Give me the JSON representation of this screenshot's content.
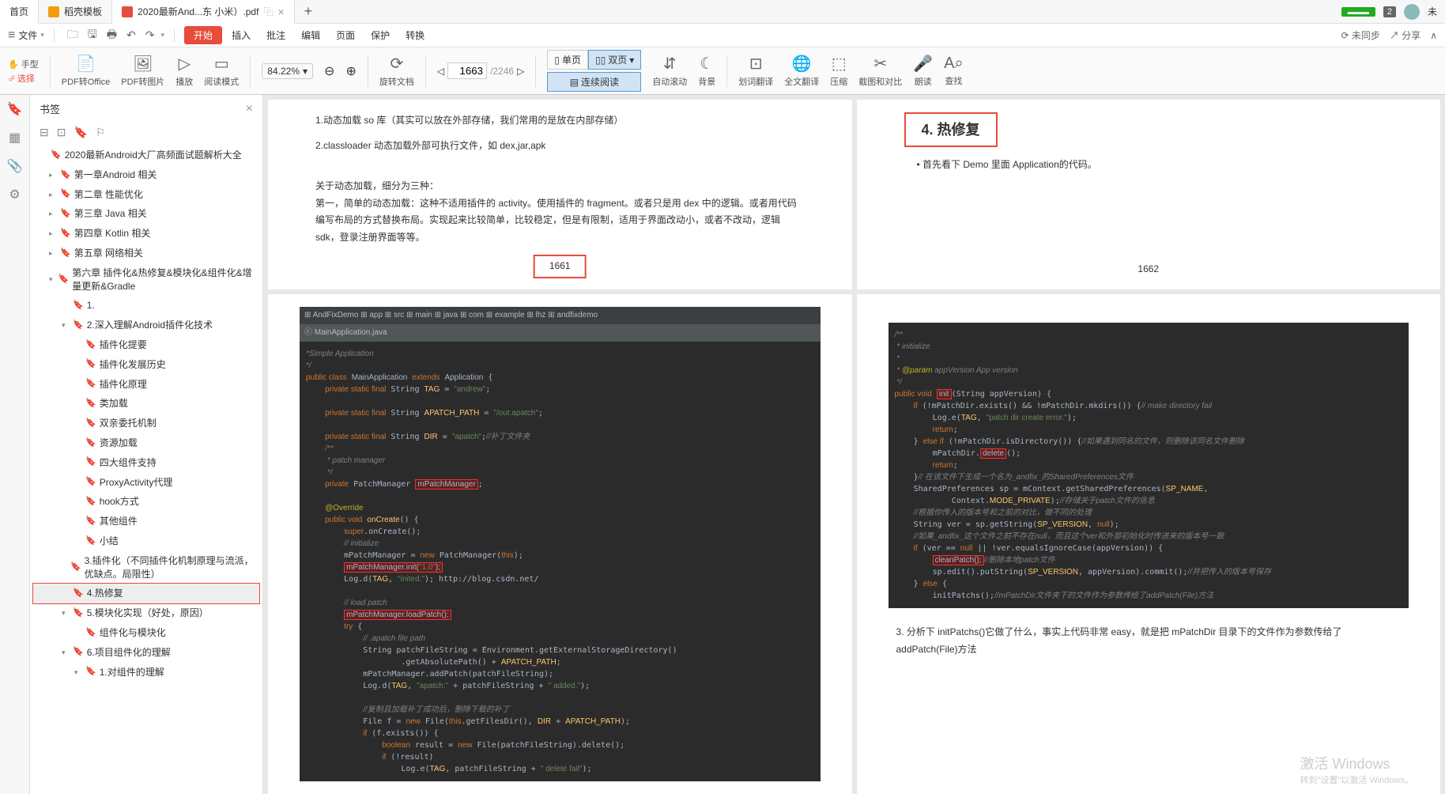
{
  "tabs": {
    "home": "首页",
    "template": "稻壳模板",
    "active": "2020最新And...东 小米）.pdf",
    "plus": "+"
  },
  "topRight": {
    "badge": "2",
    "user": "未"
  },
  "menubar": {
    "file": "文件",
    "start": "开始",
    "items": [
      "插入",
      "批注",
      "编辑",
      "页面",
      "保护",
      "转换"
    ],
    "right": {
      "notsync": "⟳ 未同步",
      "share": "↗ 分享"
    }
  },
  "tools": {
    "hand": "手型",
    "select": "选择",
    "pdf2office": "PDF转Office",
    "pdf2img": "PDF转图片",
    "play": "播放",
    "readmode": "阅读模式",
    "zoom": "84.22%",
    "rotate": "旋转文档",
    "page_current": "1663",
    "page_total": "/2246",
    "single": "单页",
    "double": "双页",
    "continuous": "连续阅读",
    "autoscroll": "自动滚动",
    "background": "背景",
    "wordtrans": "划词翻译",
    "fulltrans": "全文翻译",
    "compress": "压缩",
    "screenshot": "截图和对比",
    "read_aloud": "朗读",
    "find": "查找"
  },
  "sidebar": {
    "title": "书签",
    "tree": [
      {
        "lvl": 0,
        "label": "2020最新Android大厂高频面试题解析大全"
      },
      {
        "lvl": 1,
        "exp": false,
        "label": "第一章Android 相关"
      },
      {
        "lvl": 1,
        "exp": false,
        "label": "第二章 性能优化"
      },
      {
        "lvl": 1,
        "exp": false,
        "label": "第三章 Java 相关"
      },
      {
        "lvl": 1,
        "exp": false,
        "label": "第四章 Kotlin 相关"
      },
      {
        "lvl": 1,
        "exp": false,
        "label": "第五章 网络相关"
      },
      {
        "lvl": 1,
        "exp": true,
        "label": "第六章 插件化&热修复&模块化&组件化&增量更新&Gradle"
      },
      {
        "lvl": 2,
        "label": "1."
      },
      {
        "lvl": 2,
        "exp": true,
        "label": "2.深入理解Android插件化技术"
      },
      {
        "lvl": 3,
        "label": "插件化提要"
      },
      {
        "lvl": 3,
        "label": "插件化发展历史"
      },
      {
        "lvl": 3,
        "label": "插件化原理"
      },
      {
        "lvl": 3,
        "label": "类加载"
      },
      {
        "lvl": 3,
        "label": "双亲委托机制"
      },
      {
        "lvl": 3,
        "label": "资源加载"
      },
      {
        "lvl": 3,
        "label": "四大组件支持"
      },
      {
        "lvl": 3,
        "label": "ProxyActivity代理"
      },
      {
        "lvl": 3,
        "label": "hook方式"
      },
      {
        "lvl": 3,
        "label": "其他组件"
      },
      {
        "lvl": 3,
        "label": "小结"
      },
      {
        "lvl": 2,
        "label": "3.插件化（不同插件化机制原理与流派，优缺点。局限性）"
      },
      {
        "lvl": 2,
        "sel": true,
        "label": "4.热修复"
      },
      {
        "lvl": 2,
        "exp": true,
        "label": "5.模块化实现（好处，原因）"
      },
      {
        "lvl": 3,
        "label": "组件化与模块化"
      },
      {
        "lvl": 2,
        "exp": true,
        "label": "6.项目组件化的理解"
      },
      {
        "lvl": 3,
        "exp": true,
        "label": "1.对组件的理解"
      }
    ]
  },
  "doc": {
    "p1": {
      "l1": "1.动态加载 so 库（其实可以放在外部存储，我们常用的是放在内部存储）",
      "l2": "2.classloader 动态加载外部可执行文件，如 dex,jar,apk",
      "l3": "关于动态加载，细分为三种：",
      "l4": "第一，简单的动态加载：这种不适用插件的 activity。使用插件的 fragment。或者只是用 dex 中的逻辑。或者用代码编写布局的方式替换布局。实现起来比较简单，比较稳定，但是有限制，适用于界面改动小，或者不改动，逻辑 sdk，登录注册界面等等。",
      "num": "1661"
    },
    "p2": {
      "title": "4. 热修复",
      "bullet": "• 首先看下 Demo 里面 Application的代码。",
      "num": "1662"
    },
    "p3": {
      "codeTabs": "⊞ AndFixDemo  ⊞ app  ⊞ src  ⊞ main  ⊞ java  ⊞ com  ⊞ example  ⊞ lhz  ⊞ andfixdemo",
      "codeFile": "ⓒ MainApplication.java",
      "codeLines": [
        "<span class='cmt'>*Simple Application</span>",
        "<span class='cmt'>*/</span>",
        "<span class='kw'>public class</span> <span class='cls'>MainApplication</span> <span class='kw'>extends</span> <span class='cls'>Application</span> {",
        "    <span class='kw'>private static final</span> String <span class='fn'>TAG</span> = <span class='str'>\"andrew\"</span>;",
        "",
        "    <span class='kw'>private static final</span> String <span class='fn'>APATCH_PATH</span> = <span class='str'>\"/out.apatch\"</span>;",
        "",
        "    <span class='kw'>private static final</span> String <span class='fn'>DIR</span> = <span class='str'>\"apatch\"</span>;<span class='cmt'>//补丁文件夹</span>",
        "    <span class='cmt'>/**</span>",
        "    <span class='cmt'> * patch manager</span>",
        "    <span class='cmt'> */</span>",
        "    <span class='kw'>private</span> PatchManager <span class='hl-red'>mPatchManager</span>;",
        "",
        "    <span class='ann'>@Override</span>",
        "    <span class='kw'>public void</span> <span class='fn'>onCreate</span>() {",
        "        <span class='kw'>super</span>.onCreate();",
        "        <span class='cmt'>// initialize</span>",
        "        mPatchManager = <span class='kw'>new</span> PatchManager(<span class='kw'>this</span>);",
        "        <span class='hl-red'>mPatchManager.init(<span class='str'>\"1.0\"</span>);</span>",
        "        Log.d(<span class='fn'>TAG</span>, <span class='str'>\"inited.\"</span>); http://blog.csdn.net/",
        "",
        "        <span class='cmt'>// load patch</span>",
        "        <span class='hl-red'>mPatchManager.loadPatch();</span>",
        "        <span class='kw'>try</span> {",
        "            <span class='cmt'>// .apatch file path</span>",
        "            String patchFileString = Environment.getExternalStorageDirectory()",
        "                    .getAbsolutePath() + <span class='fn'>APATCH_PATH</span>;",
        "            mPatchManager.addPatch(patchFileString);",
        "            Log.d(<span class='fn'>TAG</span>, <span class='str'>\"apatch:\"</span> + patchFileString + <span class='str'>\" added.\"</span>);",
        "",
        "            <span class='cmt'>//复制且加载补丁成功后，删除下载的补丁</span>",
        "            File f = <span class='kw'>new</span> File(<span class='kw'>this</span>.getFilesDir(), <span class='fn'>DIR</span> + <span class='fn'>APATCH_PATH</span>);",
        "            <span class='kw'>if</span> (f.exists()) {",
        "                <span class='kw'>boolean</span> result = <span class='kw'>new</span> File(patchFileString).delete();",
        "                <span class='kw'>if</span> (!result)",
        "                    Log.e(<span class='fn'>TAG</span>, patchFileString + <span class='str'>\" delete fail\"</span>);"
      ]
    },
    "p4": {
      "codeLines": [
        "<span class='cmt'>/**</span>",
        "<span class='cmt'> * initialize</span>",
        "<span class='cmt'> *</span>",
        "<span class='cmt'> * <span class='ann'>@param</span> appVersion App version</span>",
        "<span class='cmt'> */</span>",
        "<span class='kw'>public void</span> <span class='hl-red'>init</span>(String appVersion) {",
        "    <span class='kw'>if</span> (!mPatchDir.exists() && !mPatchDir.mkdirs()) {<span class='cmt'>// make directory fail</span>",
        "        Log.e(<span class='fn'>TAG</span>, <span class='str'>\"patch dir create error.\"</span>);",
        "        <span class='kw'>return</span>;",
        "    } <span class='kw'>else if</span> (!mPatchDir.isDirectory()) {<span class='cmt'>//如果遇到同名的文件，则删除该同名文件删除</span>",
        "        mPatchDir.<span class='hl-red'>delete</span>();",
        "        <span class='kw'>return</span>;",
        "    }<span class='cmt'>// 在该文件下生成一个名为_andfix_的SharedPreferences文件</span>",
        "    SharedPreferences sp = mContext.getSharedPreferences(<span class='fn'>SP_NAME</span>,",
        "            Context.<span class='fn'>MODE_PRIVATE</span>);<span class='cmt'>//存储关于patch文件的信息</span>",
        "    <span class='cmt'>//根据你传入的版本号和之前的对比，做不同的处理</span>",
        "    String ver = sp.getString(<span class='fn'>SP_VERSION</span>, <span class='kw'>null</span>);",
        "    <span class='cmt'>//如果_andfix_这个文件之前不存在null，而且这个ver和外部初始化时传进来的版本号一致</span>",
        "    <span class='kw'>if</span> (ver == <span class='kw'>null</span> || !ver.equalsIgnoreCase(appVersion)) {",
        "        <span class='hl-red'>cleanPatch();</span><span class='cmt'>//删除本地patch文件</span>",
        "        sp.edit().putString(<span class='fn'>SP_VERSION</span>, appVersion).commit();<span class='cmt'>//并把传入的版本号保存</span>",
        "    } <span class='kw'>else</span> {",
        "        initPatchs();<span class='cmt'>//mPatchDir文件夹下的文件作为参数传给了addPatch(File)方法</span>"
      ],
      "t1": "3. 分析下 initPatchs()它做了什么，事实上代码非常 easy，就是把 mPatchDir 目录下的文件作为参数传给了 addPatch(File)方法"
    }
  },
  "watermark": {
    "l1": "激活 Windows",
    "l2": "转到\"设置\"以激活 Windows。"
  }
}
